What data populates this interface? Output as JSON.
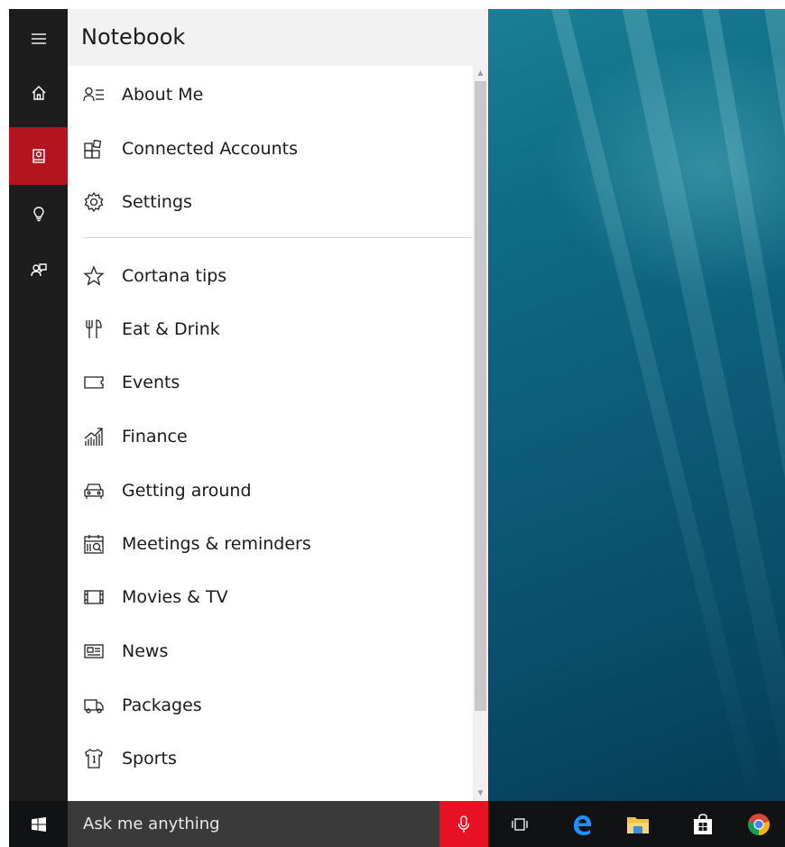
{
  "notebook": {
    "title": "Notebook",
    "top_items": [
      {
        "label": "About Me",
        "icon": "about-me-icon"
      },
      {
        "label": "Connected Accounts",
        "icon": "connected-accounts-icon"
      },
      {
        "label": "Settings",
        "icon": "settings-gear-icon"
      }
    ],
    "items": [
      {
        "label": "Cortana tips",
        "icon": "star-icon"
      },
      {
        "label": "Eat & Drink",
        "icon": "fork-knife-icon"
      },
      {
        "label": "Events",
        "icon": "ticket-icon"
      },
      {
        "label": "Finance",
        "icon": "finance-chart-icon"
      },
      {
        "label": "Getting around",
        "icon": "car-icon"
      },
      {
        "label": "Meetings & reminders",
        "icon": "calendar-icon"
      },
      {
        "label": "Movies & TV",
        "icon": "film-icon"
      },
      {
        "label": "News",
        "icon": "newspaper-icon"
      },
      {
        "label": "Packages",
        "icon": "truck-icon"
      },
      {
        "label": "Sports",
        "icon": "jersey-icon"
      }
    ]
  },
  "rail": {
    "items": [
      {
        "name": "menu",
        "icon": "hamburger-icon",
        "active": false
      },
      {
        "name": "home",
        "icon": "home-icon",
        "active": false
      },
      {
        "name": "notebook",
        "icon": "notebook-icon",
        "active": true
      },
      {
        "name": "tips",
        "icon": "lightbulb-icon",
        "active": false
      },
      {
        "name": "feedback",
        "icon": "feedback-icon",
        "active": false
      }
    ],
    "active_color": "#b4141e"
  },
  "taskbar": {
    "search_placeholder": "Ask me anything",
    "mic_color": "#e81123",
    "apps": [
      "task-view-icon",
      "edge-icon",
      "file-explorer-icon",
      "store-icon",
      "chrome-icon"
    ]
  }
}
